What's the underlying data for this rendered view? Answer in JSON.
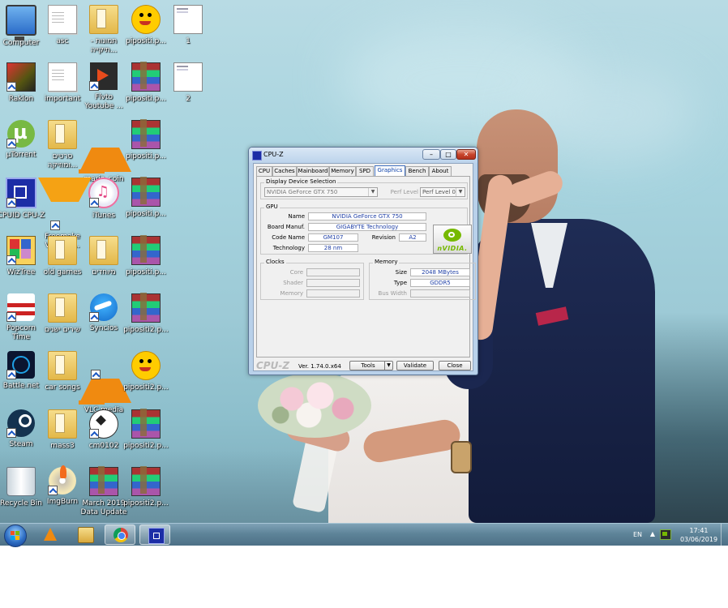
{
  "desktop": {
    "icons": [
      {
        "label": "Computer",
        "icon": "computer-icon",
        "shortcut": false
      },
      {
        "label": "asc",
        "icon": "document-icon",
        "shortcut": false
      },
      {
        "label": "תמונות - תיקייה...",
        "icon": "folder-icon",
        "shortcut": false
      },
      {
        "label": "pipositi.p...",
        "icon": "pacman-icon",
        "shortcut": false
      },
      {
        "label": "1",
        "icon": "screenshot-icon",
        "shortcut": false
      },
      {
        "label": "Raklon",
        "icon": "raklon-icon",
        "shortcut": true
      },
      {
        "label": "important",
        "icon": "document-icon",
        "shortcut": false
      },
      {
        "label": "Flvto Youtube ...",
        "icon": "flvto-icon",
        "shortcut": true
      },
      {
        "label": "pipositi.p...",
        "icon": "winrar-icon",
        "shortcut": false
      },
      {
        "label": "2",
        "icon": "screenshot-icon",
        "shortcut": false
      },
      {
        "label": "µTorrent",
        "icon": "utorrent-icon",
        "shortcut": true
      },
      {
        "label": "סרטים ומוזיקה...",
        "icon": "folder-icon",
        "shortcut": false
      },
      {
        "label": "mario_coin",
        "icon": "vlc-icon",
        "shortcut": false
      },
      {
        "label": "pipositi.p...",
        "icon": "winrar-icon",
        "shortcut": false
      },
      {
        "label": "CPUID CPU-Z",
        "icon": "cpuid-icon",
        "shortcut": true
      },
      {
        "label": "Freemake Video C...",
        "icon": "freemake-icon",
        "shortcut": true
      },
      {
        "label": "iTunes",
        "icon": "itunes-icon",
        "shortcut": true
      },
      {
        "label": "pipositi.p...",
        "icon": "winrar-icon",
        "shortcut": false
      },
      {
        "label": "WizTree",
        "icon": "wiztree-icon",
        "shortcut": true
      },
      {
        "label": "old games",
        "icon": "folder-icon",
        "shortcut": false
      },
      {
        "label": "מיוחדים",
        "icon": "folder-icon",
        "shortcut": false
      },
      {
        "label": "pipositi.p...",
        "icon": "winrar-icon",
        "shortcut": false
      },
      {
        "label": "Popcorn Time",
        "icon": "popcorn-icon",
        "shortcut": true
      },
      {
        "label": "שירים ישנים",
        "icon": "folder-icon",
        "shortcut": false
      },
      {
        "label": "Syncios",
        "icon": "syncios-icon",
        "shortcut": true
      },
      {
        "label": "pipositi2.p...",
        "icon": "winrar-icon",
        "shortcut": false
      },
      {
        "label": "Battle.net",
        "icon": "battlenet-icon",
        "shortcut": true
      },
      {
        "label": "car songs",
        "icon": "folder-icon",
        "shortcut": false
      },
      {
        "label": "VLC media player",
        "icon": "vlc-icon",
        "shortcut": true
      },
      {
        "label": "pipositi2.p...",
        "icon": "pacman-icon",
        "shortcut": false
      },
      {
        "label": "Steam",
        "icon": "steam-icon",
        "shortcut": true
      },
      {
        "label": "mass3",
        "icon": "folder-icon",
        "shortcut": false
      },
      {
        "label": "cm0102",
        "icon": "soccer-ball-icon",
        "shortcut": true
      },
      {
        "label": "pipositi2.p...",
        "icon": "winrar-icon",
        "shortcut": false
      },
      {
        "label": "Recycle Bin",
        "icon": "recycle-bin-icon",
        "shortcut": false
      },
      {
        "label": "ImgBurn",
        "icon": "imgburn-icon",
        "shortcut": true
      },
      {
        "label": "March 2019 Data Update",
        "icon": "winrar-icon",
        "shortcut": false
      },
      {
        "label": "pipositi2.p...",
        "icon": "winrar-icon",
        "shortcut": false
      }
    ]
  },
  "cpuz": {
    "title": "CPU-Z",
    "window_buttons": {
      "minimize": "–",
      "maximize": "□",
      "close": "✕"
    },
    "tabs": [
      {
        "label": "CPU",
        "active": false
      },
      {
        "label": "Caches",
        "active": false
      },
      {
        "label": "Mainboard",
        "active": false
      },
      {
        "label": "Memory",
        "active": false
      },
      {
        "label": "SPD",
        "active": false
      },
      {
        "label": "Graphics",
        "active": true
      },
      {
        "label": "Bench",
        "active": false
      },
      {
        "label": "About",
        "active": false
      }
    ],
    "display_selection": {
      "group_label": "Display Device Selection",
      "device": "NVIDIA GeForce GTX 750",
      "perf_level_label": "Perf Level",
      "perf_level_value": "Perf Level 0"
    },
    "gpu": {
      "group_label": "GPU",
      "name_label": "Name",
      "name": "NVIDIA GeForce GTX 750",
      "board_manuf_label": "Board Manuf.",
      "board_manuf": "GIGABYTE Technology",
      "code_name_label": "Code Name",
      "code_name": "GM107",
      "revision_label": "Revision",
      "revision": "A2",
      "technology_label": "Technology",
      "technology": "28 nm",
      "logo_text": "nVIDIA."
    },
    "clocks": {
      "group_label": "Clocks",
      "core_label": "Core",
      "shader_label": "Shader",
      "memory_label": "Memory",
      "core": "",
      "shader": "",
      "memory": ""
    },
    "memory": {
      "group_label": "Memory",
      "size_label": "Size",
      "size": "2048 MBytes",
      "type_label": "Type",
      "type": "GDDR5",
      "bus_width_label": "Bus Width",
      "bus_width": ""
    },
    "footer": {
      "brand": "CPU-Z",
      "version": "Ver. 1.74.0.x64",
      "tools_label": "Tools",
      "validate_label": "Validate",
      "close_label": "Close"
    }
  },
  "taskbar": {
    "pinned": [
      {
        "name": "vlc",
        "icon": "vlc-icon",
        "active": false
      },
      {
        "name": "explorer",
        "icon": "folder-icon",
        "active": false
      },
      {
        "name": "chrome",
        "icon": "chrome-icon",
        "active": true
      },
      {
        "name": "cpuz",
        "icon": "cpuz-icon",
        "active": true
      }
    ],
    "tray": {
      "language": "EN",
      "show_hidden": "▲",
      "time": "17:41",
      "date": "03/06/2019"
    }
  }
}
